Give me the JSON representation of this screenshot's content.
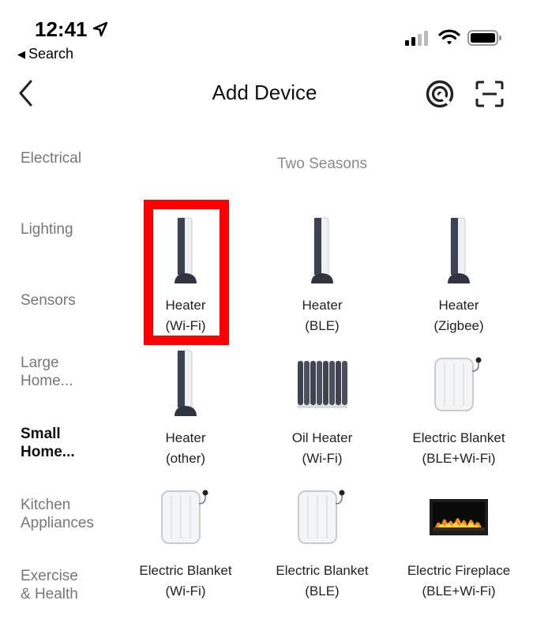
{
  "status_bar": {
    "time": "12:41",
    "back_app_label": "Search"
  },
  "nav": {
    "title": "Add Device"
  },
  "sidebar": {
    "items": [
      {
        "line1": "Electrical",
        "line2": ""
      },
      {
        "line1": "Lighting",
        "line2": ""
      },
      {
        "line1": "Sensors",
        "line2": ""
      },
      {
        "line1": "Large",
        "line2": "Home..."
      },
      {
        "line1": "Small",
        "line2": "Home..."
      },
      {
        "line1": "Kitchen",
        "line2": "Appliances"
      },
      {
        "line1": "Exercise",
        "line2": "& Health"
      }
    ],
    "active_index": 4
  },
  "content": {
    "section_title": "Two Seasons",
    "devices": [
      {
        "name": "Heater",
        "variant": "(Wi-Fi)",
        "icon": "tower-heater-icon"
      },
      {
        "name": "Heater",
        "variant": "(BLE)",
        "icon": "tower-heater-icon"
      },
      {
        "name": "Heater",
        "variant": "(Zigbee)",
        "icon": "tower-heater-icon"
      },
      {
        "name": "Heater",
        "variant": "(other)",
        "icon": "tower-heater-icon"
      },
      {
        "name": "Oil Heater",
        "variant": "(Wi-Fi)",
        "icon": "oil-heater-icon"
      },
      {
        "name": "Electric Blanket",
        "variant": "(BLE+Wi-Fi)",
        "icon": "electric-blanket-icon"
      },
      {
        "name": "Electric Blanket",
        "variant": "(Wi-Fi)",
        "icon": "electric-blanket-icon"
      },
      {
        "name": "Electric Blanket",
        "variant": "(BLE)",
        "icon": "electric-blanket-icon"
      },
      {
        "name": "Electric Fireplace",
        "variant": "(BLE+Wi-Fi)",
        "icon": "electric-fireplace-icon"
      }
    ]
  },
  "colors": {
    "highlight": "#ff0000",
    "sidebar_inactive": "#777777",
    "section_title": "#8a8a8a"
  }
}
